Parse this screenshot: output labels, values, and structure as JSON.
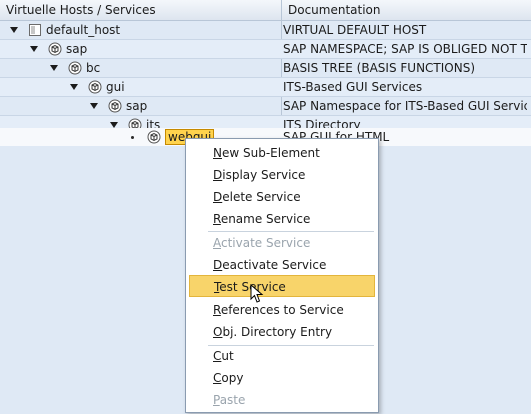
{
  "header": {
    "col1": "Virtuelle Hosts / Services",
    "col2": "Documentation"
  },
  "rows": [
    {
      "label": "default_host",
      "doc": "VIRTUAL DEFAULT HOST"
    },
    {
      "label": "sap",
      "doc": "SAP NAMESPACE; SAP IS OBLIGED NOT T..."
    },
    {
      "label": "bc",
      "doc": "BASIS TREE (BASIS FUNCTIONS)"
    },
    {
      "label": "gui",
      "doc": "ITS-Based GUI Services"
    },
    {
      "label": "sap",
      "doc": "SAP Namespace for ITS-Based GUI Services"
    },
    {
      "label": "its",
      "doc": "ITS Directory"
    },
    {
      "label": "webgui",
      "doc": "SAP GUI for HTML"
    }
  ],
  "menu": {
    "items": [
      {
        "label": "New Sub-Element",
        "ul": "N",
        "enabled": true
      },
      {
        "label": "Display Service",
        "ul": "D",
        "enabled": true
      },
      {
        "label": "Delete Service",
        "ul": "D",
        "enabled": true
      },
      {
        "label": "Rename Service",
        "ul": "R",
        "enabled": true
      },
      {
        "label": "Activate Service",
        "ul": "A",
        "enabled": false
      },
      {
        "label": "Deactivate Service",
        "ul": "D",
        "enabled": true
      },
      {
        "label": "Test Service",
        "ul": "T",
        "enabled": true,
        "hover": true
      },
      {
        "label": "References to Service",
        "ul": "R",
        "enabled": true
      },
      {
        "label": "Obj. Directory Entry",
        "ul": "O",
        "enabled": true
      },
      {
        "label": "Cut",
        "ul": "C",
        "enabled": true
      },
      {
        "label": "Copy",
        "ul": "C",
        "enabled": true
      },
      {
        "label": "Paste",
        "ul": "P",
        "enabled": false
      }
    ]
  },
  "colors": {
    "highlight": "#f8d46a",
    "selected_node": "#ffd34d",
    "disabled_text": "#9aa4ad"
  }
}
